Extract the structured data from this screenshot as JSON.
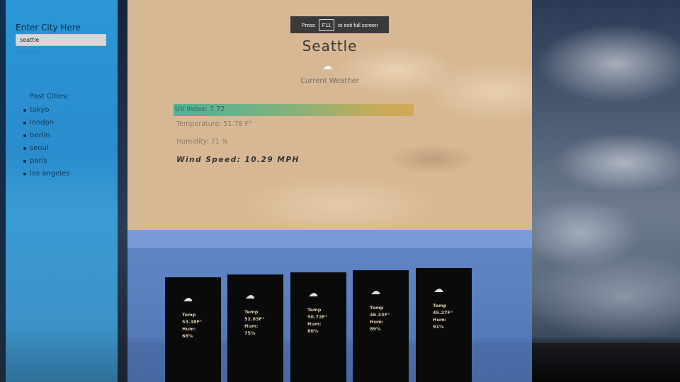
{
  "sidebar": {
    "enter_label": "Enter City Here",
    "input_value": "seattle",
    "search_label": "Search",
    "past_title": "Past Cities:",
    "past_cities": [
      "tokyo",
      "london",
      "berlin",
      "seoul",
      "paris",
      "los angeles"
    ]
  },
  "fullscreen_notice": {
    "press": "Press",
    "key": "F11",
    "suffix": "to exit full screen"
  },
  "current": {
    "city": "Seattle",
    "icon": "cloud-icon",
    "label": "Current Weather",
    "uv": "UV Index: 7.72",
    "temperature": "Temperature: 51.78 F°",
    "humidity": "Humidity: 71 %",
    "wind": "Wind Speed: 10.29 MPH"
  },
  "forecast": [
    {
      "temp_label": "Temp",
      "temp": "53.38F°",
      "hum_label": "Hum:",
      "hum": "68%",
      "icon": "cloud-icon"
    },
    {
      "temp_label": "Temp",
      "temp": "52.83F°",
      "hum_label": "Hum:",
      "hum": "75%",
      "icon": "cloud-icon"
    },
    {
      "temp_label": "Temp",
      "temp": "50.72F°",
      "hum_label": "Hum:",
      "hum": "80%",
      "icon": "cloud-icon"
    },
    {
      "temp_label": "Temp",
      "temp": "46.33F°",
      "hum_label": "Hum:",
      "hum": "89%",
      "icon": "cloud-icon"
    },
    {
      "temp_label": "Temp",
      "temp": "45.27F°",
      "hum_label": "Hum:",
      "hum": "91%",
      "icon": "cloud-icon"
    }
  ]
}
